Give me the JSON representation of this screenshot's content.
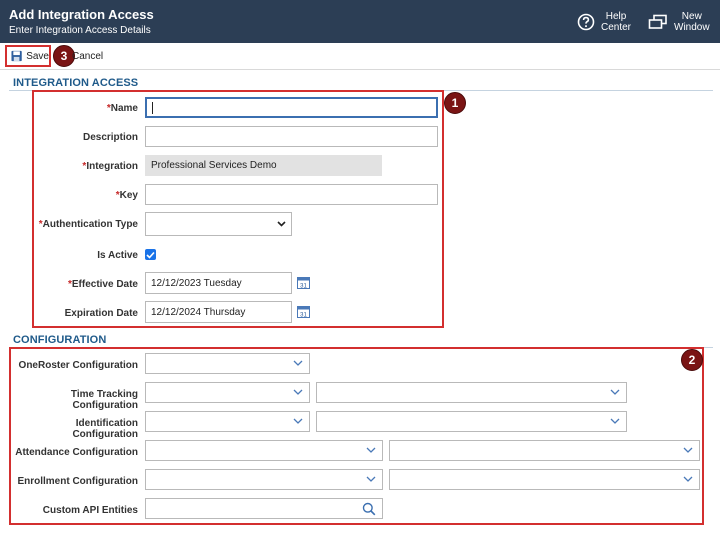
{
  "header": {
    "title": "Add Integration Access",
    "subtitle": "Enter Integration Access Details",
    "help_label_1": "Help",
    "help_label_2": "Center",
    "newwin_label_1": "New",
    "newwin_label_2": "Window"
  },
  "toolbar": {
    "save_label": "Save",
    "cancel_label": "Cancel"
  },
  "badges": [
    "1",
    "2",
    "3"
  ],
  "integration_access": {
    "section_title": "INTEGRATION ACCESS",
    "name_label": "Name",
    "name_value": "",
    "description_label": "Description",
    "description_value": "",
    "integration_label": "Integration",
    "integration_value": "Professional Services Demo",
    "key_label": "Key",
    "key_value": "",
    "auth_type_label": "Authentication Type",
    "auth_type_value": "",
    "is_active_label": "Is Active",
    "is_active_checked": true,
    "effective_date_label": "Effective Date",
    "effective_date_value": "12/12/2023 Tuesday",
    "expiration_date_label": "Expiration Date",
    "expiration_date_value": "12/12/2024 Thursday",
    "calendar_day": "31",
    "required_marker": "*"
  },
  "configuration": {
    "section_title": "CONFIGURATION",
    "oneroster_label": "OneRoster Configuration",
    "time_tracking_label": "Time Tracking Configuration",
    "identification_label": "Identification Configuration",
    "attendance_label": "Attendance Configuration",
    "enrollment_label": "Enrollment Configuration",
    "custom_api_label": "Custom API Entities"
  },
  "colors": {
    "header_bg": "#2c3e55",
    "highlight_red": "#d32f2f",
    "badge_bg": "#7a1414",
    "section_blue": "#1f5a8a",
    "checkbox_blue": "#1a73e8"
  }
}
